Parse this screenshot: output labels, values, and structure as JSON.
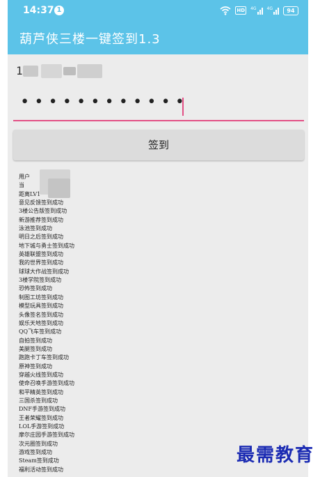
{
  "status_bar": {
    "time": "14:37",
    "notification_count": "1",
    "battery": "94",
    "hd_label": "HD",
    "net_label_1": "4G",
    "net_label_2": "4G"
  },
  "app_bar": {
    "title": "葫芦侠三楼一键签到1.3"
  },
  "form": {
    "username_value": "1",
    "password_value": "••••••••••••",
    "submit_label": "签到"
  },
  "log": {
    "lines": [
      "用户",
      "当",
      "距离LV1",
      "意见反馈签到成功",
      "3楼公告版签到成功",
      "新游推荐签到成功",
      "泳池签到成功",
      "明日之后签到成功",
      "地下城与勇士签到成功",
      "英雄联盟签到成功",
      "我的世界签到成功",
      "球球大作战签到成功",
      "3楼学院签到成功",
      "恐怖签到成功",
      "制图工坊签到成功",
      "模型玩具签到成功",
      "头像签名签到成功",
      "娱乐天地签到成功",
      "QQ飞车签到成功",
      "自拍签到成功",
      "美腿签到成功",
      "跑跑卡丁车签到成功",
      "原神签到成功",
      "穿越火线签到成功",
      "使命召唤手游签到成功",
      "和平精英签到成功",
      "三国杀签到成功",
      "DNF手游签到成功",
      "王者荣耀签到成功",
      "LOL手游签到成功",
      "摩尔庄园手游签到成功",
      "次元圈签到成功",
      "游戏签到成功",
      "Steam签到成功",
      "福利活动签到成功"
    ]
  },
  "watermark": {
    "text": "最需教育"
  },
  "colors": {
    "accent": "#5cc3e8",
    "underline": "#e24f85",
    "watermark": "#1b2bb3"
  }
}
